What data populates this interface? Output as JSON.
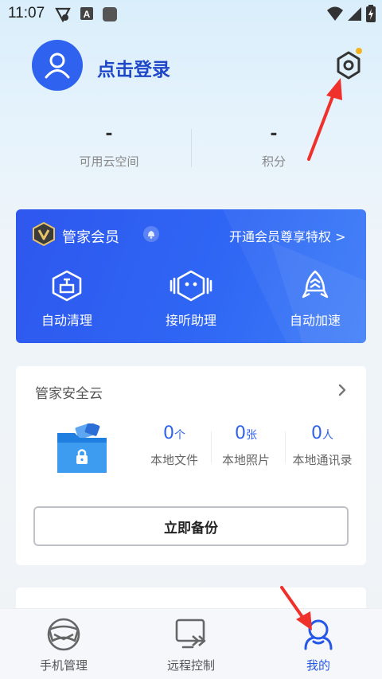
{
  "status_bar": {
    "time": "11:07",
    "icons": [
      "vpn-key-icon",
      "font-a-icon",
      "app-square-icon",
      "wifi-icon",
      "signal-icon",
      "battery-charging-icon"
    ]
  },
  "profile": {
    "login_label": "点击登录",
    "avatar_icon": "user-icon",
    "settings_icon": "gear-icon",
    "settings_dot_color": "#f6b321"
  },
  "stats": [
    {
      "value": "-",
      "label": "可用云空间"
    },
    {
      "value": "-",
      "label": "积分"
    }
  ],
  "vip": {
    "title": "管家会员",
    "link": "开通会员尊享特权 >",
    "features": [
      {
        "icon": "auto-clean-icon",
        "label": "自动清理"
      },
      {
        "icon": "call-assistant-icon",
        "label": "接听助理"
      },
      {
        "icon": "rocket-icon",
        "label": "自动加速"
      }
    ],
    "bg_color": "#2f62ee"
  },
  "cloud": {
    "title": "管家安全云",
    "counts": [
      {
        "num": "0",
        "unit": "个",
        "label": "本地文件"
      },
      {
        "num": "0",
        "unit": "张",
        "label": "本地照片"
      },
      {
        "num": "0",
        "unit": "人",
        "label": "本地通讯录"
      }
    ],
    "backup_label": "立即备份"
  },
  "tabs": [
    {
      "label": "手机管理",
      "icon": "shield-face-icon",
      "active": false
    },
    {
      "label": "远程控制",
      "icon": "remote-screen-icon",
      "active": false
    },
    {
      "label": "我的",
      "icon": "profile-icon",
      "active": true
    }
  ],
  "accent_color": "#2557e8",
  "annotation_color": "#f0302a"
}
